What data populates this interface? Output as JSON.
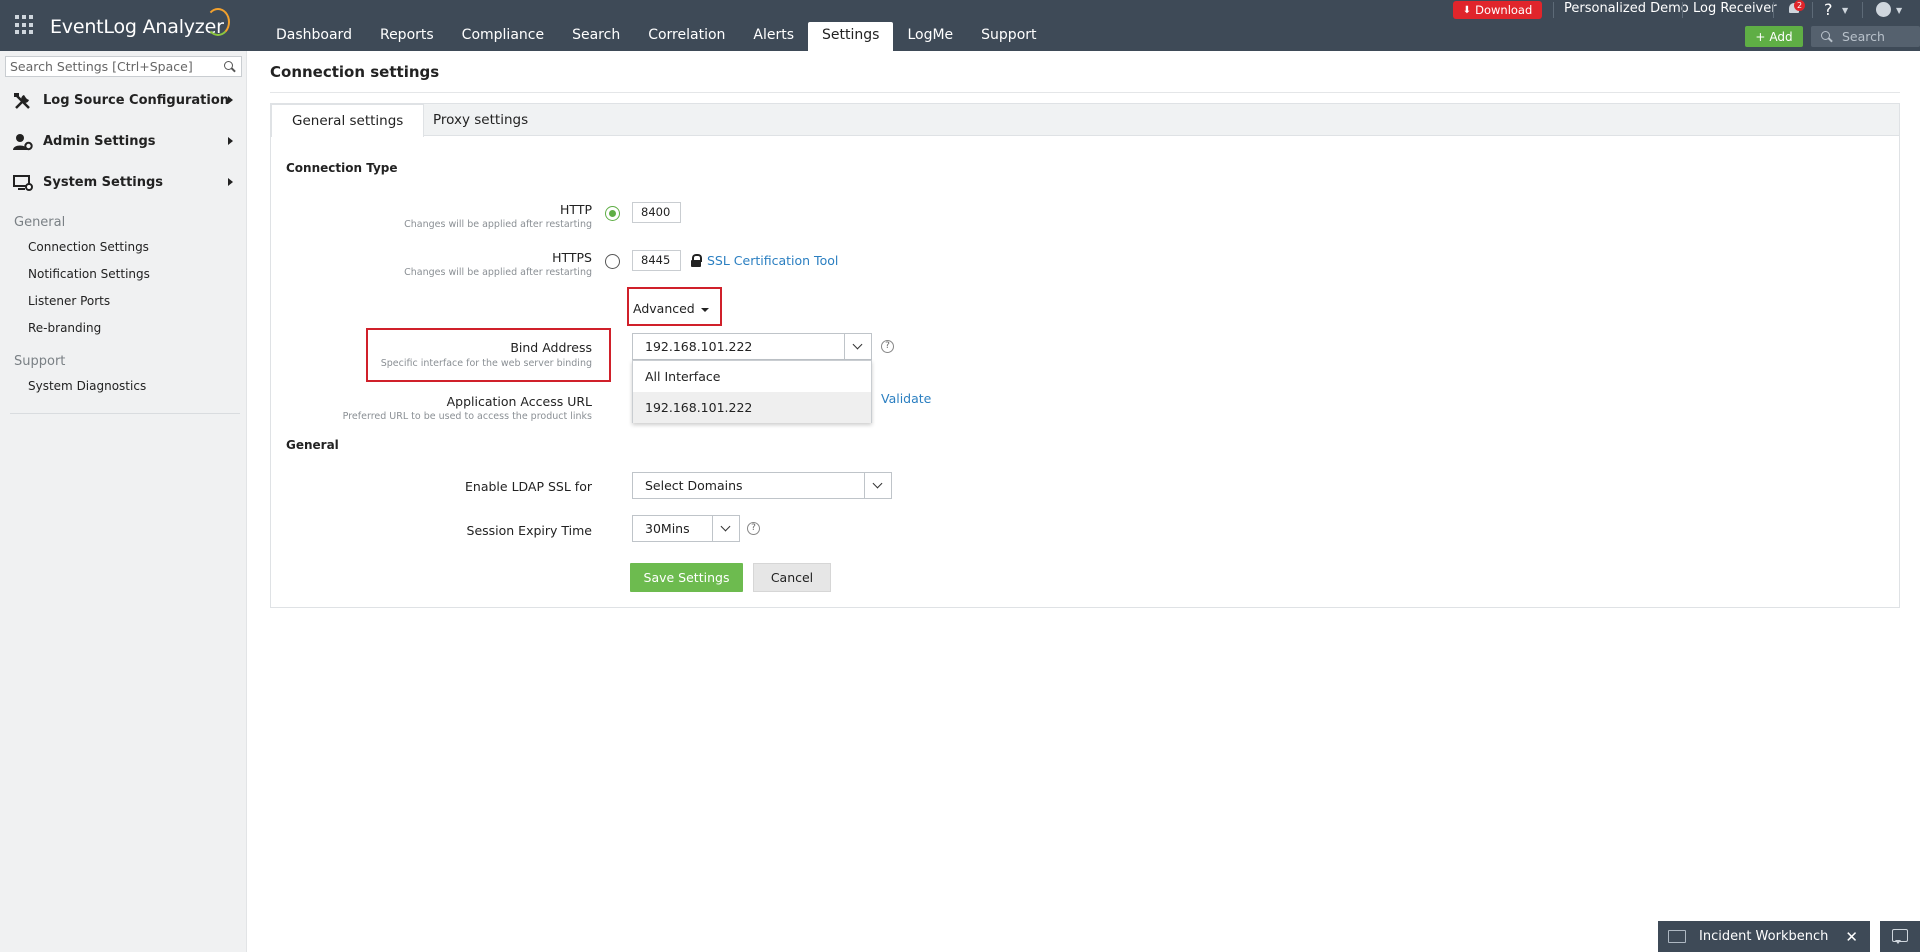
{
  "header": {
    "logo_text": "EventLog Analyzer",
    "nav_tabs": [
      {
        "label": "Dashboard"
      },
      {
        "label": "Reports"
      },
      {
        "label": "Compliance"
      },
      {
        "label": "Search"
      },
      {
        "label": "Correlation"
      },
      {
        "label": "Alerts"
      },
      {
        "label": "Settings",
        "active": true
      },
      {
        "label": "LogMe"
      },
      {
        "label": "Support"
      }
    ],
    "download_label": "Download",
    "personalized_demo": "Personalized Demo",
    "log_receiver": "Log Receiver",
    "notification_count": "2",
    "help_label": "?",
    "add_label": "Add",
    "search_placeholder": "Search",
    "accent_color": "#5fae45",
    "download_color": "#e0252b"
  },
  "sidebar": {
    "search_placeholder": "Search Settings [Ctrl+Space]",
    "menus": [
      {
        "label": "Log Source Configuration",
        "icon": "tools-icon"
      },
      {
        "label": "Admin Settings",
        "icon": "admin-user-gear-icon"
      },
      {
        "label": "System Settings",
        "icon": "monitor-gear-icon"
      }
    ],
    "general_heading": "General",
    "general_items": [
      "Connection Settings",
      "Notification Settings",
      "Listener Ports",
      "Re-branding"
    ],
    "support_heading": "Support",
    "support_items": [
      "System Diagnostics"
    ]
  },
  "main": {
    "title": "Connection settings",
    "tabs": [
      {
        "label": "General settings",
        "active": true
      },
      {
        "label": "Proxy settings"
      }
    ],
    "connection_type_heading": "Connection Type",
    "http": {
      "label": "HTTP",
      "hint": "Changes will be applied after restarting",
      "port": "8400",
      "selected": true
    },
    "https": {
      "label": "HTTPS",
      "hint": "Changes will be applied after restarting",
      "port": "8445",
      "ssl_tool_label": "SSL Certification Tool"
    },
    "advanced_label": "Advanced",
    "bind_address": {
      "label": "Bind Address",
      "hint": "Specific interface for the web server binding",
      "value": "192.168.101.222",
      "options": [
        "All Interface",
        "192.168.101.222"
      ]
    },
    "app_access_url": {
      "label": "Application Access URL",
      "hint": "Preferred URL to be used to access the product links",
      "validate_label": "Validate"
    },
    "general_heading": "General",
    "ldap_ssl": {
      "label": "Enable LDAP SSL for",
      "value": "Select Domains"
    },
    "session_expiry": {
      "label": "Session Expiry Time",
      "value": "30Mins"
    },
    "save_label": "Save Settings",
    "cancel_label": "Cancel"
  },
  "footer": {
    "incident_workbench_label": "Incident Workbench"
  }
}
